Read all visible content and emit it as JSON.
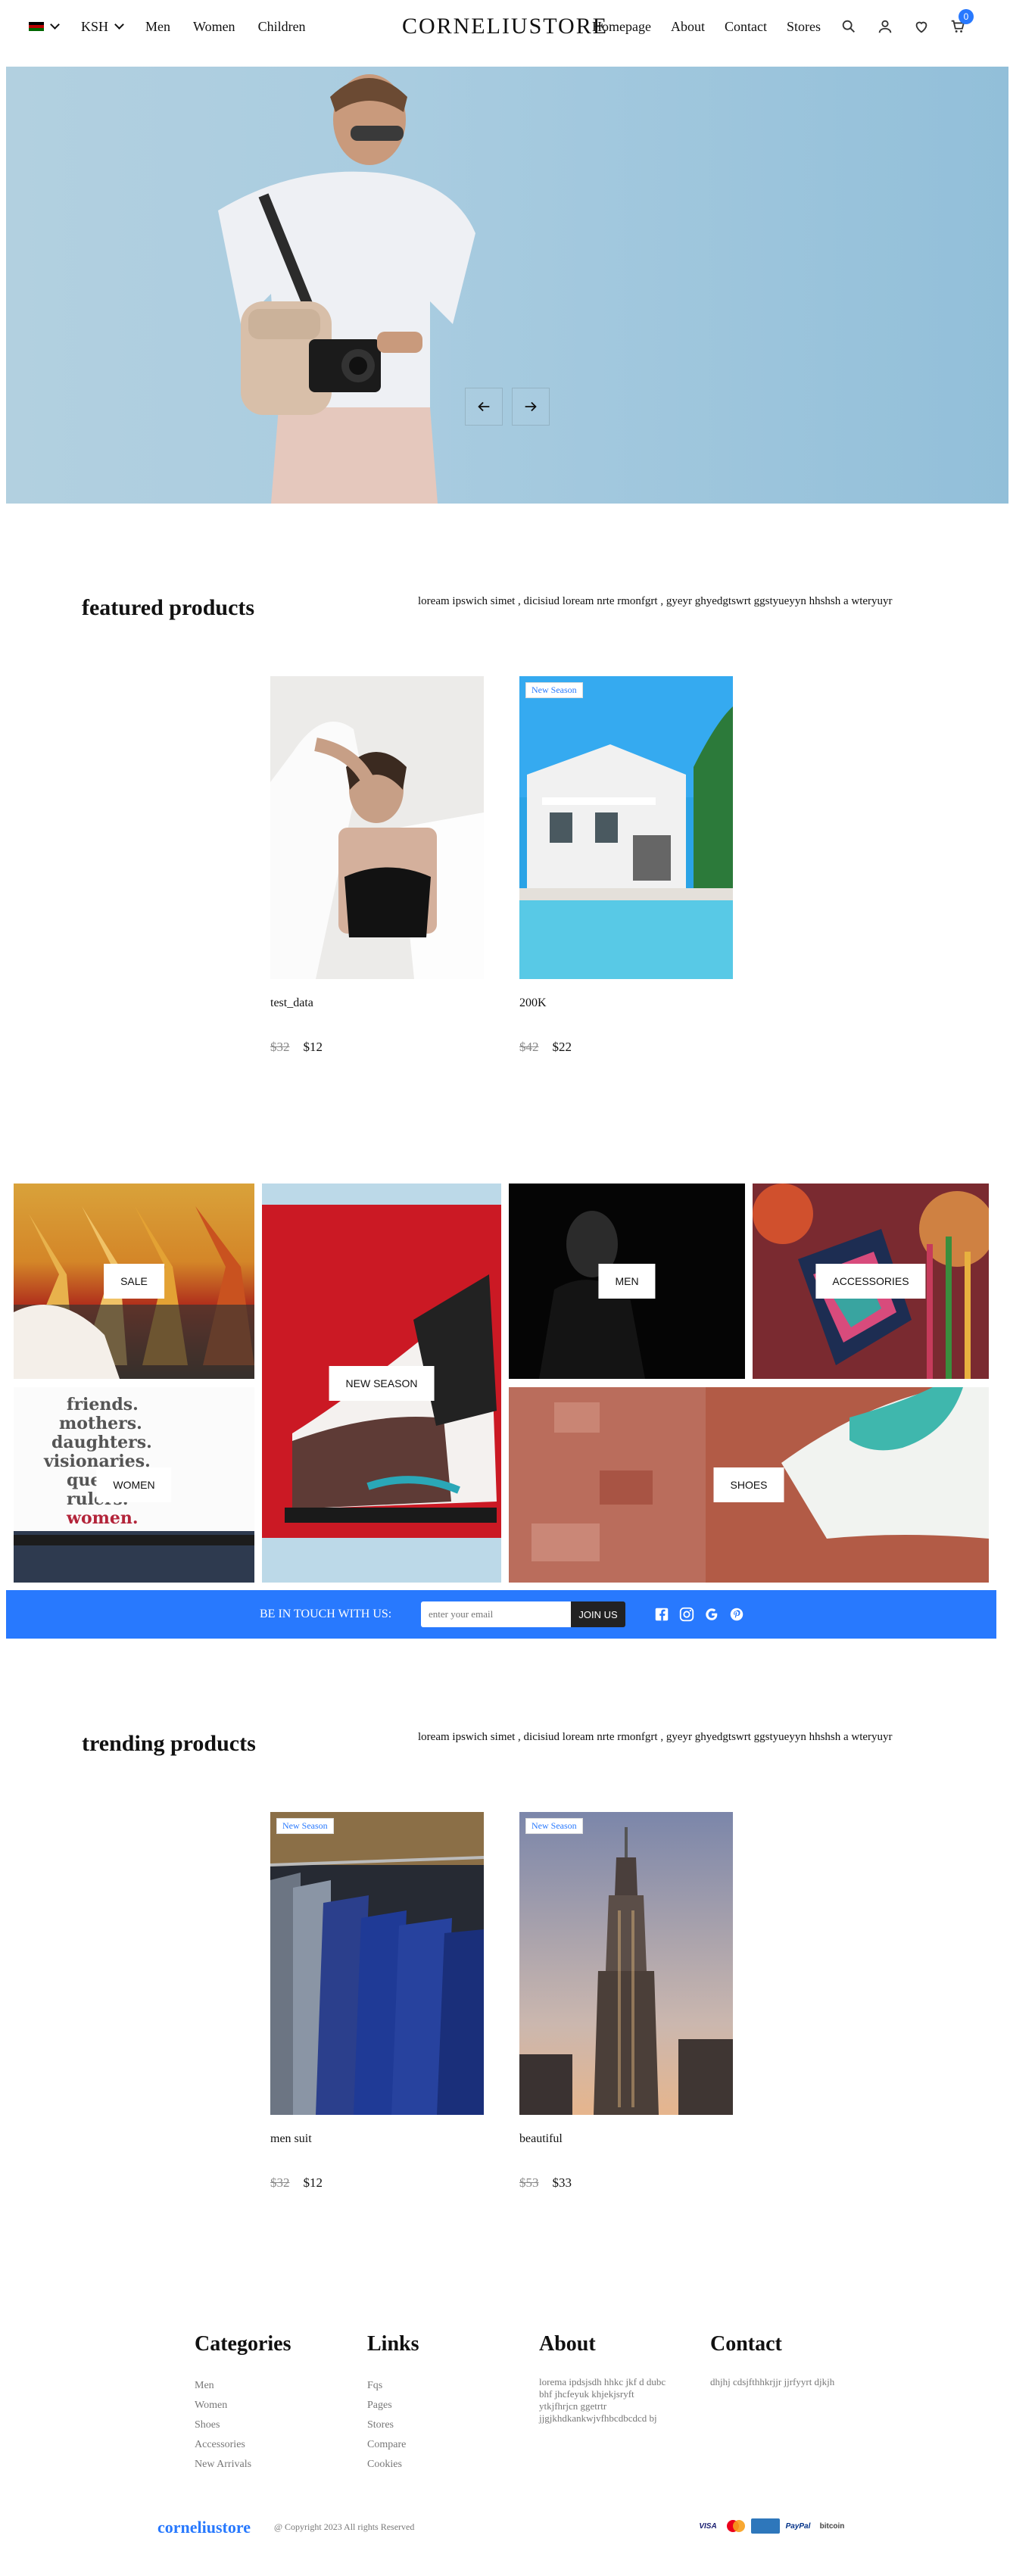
{
  "nav": {
    "currency": "KSH",
    "left_links": [
      "Men",
      "Women",
      "Children"
    ],
    "brand": "CORNELIUSTORE",
    "right_links": [
      "Homepage",
      "About",
      "Contact",
      "Stores"
    ],
    "cart_count": "0",
    "icons": [
      "search-icon",
      "user-icon",
      "heart-icon",
      "cart-icon"
    ]
  },
  "hero": {
    "prev_icon": "arrow-left-icon",
    "next_icon": "arrow-right-icon"
  },
  "featured": {
    "title": "featured products",
    "description": "loream ipswich simet , dicisiud loream nrte rmonfgrt , gyeyr ghyedgtswrt ggstyueyyn hhshsh a wteryuyr",
    "products": [
      {
        "name": "test_data",
        "old_price": "$32",
        "price": "$12",
        "badge": ""
      },
      {
        "name": "200K",
        "old_price": "$42",
        "price": "$22",
        "badge": "New Season"
      }
    ]
  },
  "categories": {
    "sale": "SALE",
    "women": "WOMEN",
    "new_season": "NEW SEASON",
    "men": "MEN",
    "accessories": "ACCESSORIES",
    "shoes": "SHOES",
    "tshirt_text": [
      "friends.",
      "mothers.",
      "daughters.",
      "visionaries.",
      "queens.",
      "rulers.",
      "women."
    ]
  },
  "newsletter": {
    "title": "BE IN TOUCH WITH US:",
    "placeholder": "enter your email",
    "button": "JOIN US",
    "social": [
      "facebook-icon",
      "instagram-icon",
      "google-icon",
      "pinterest-icon"
    ]
  },
  "trending": {
    "title": "trending products",
    "description": "loream ipswich simet , dicisiud loream nrte rmonfgrt , gyeyr ghyedgtswrt ggstyueyyn hhshsh a wteryuyr",
    "products": [
      {
        "name": "men suit",
        "old_price": "$32",
        "price": "$12",
        "badge": "New Season"
      },
      {
        "name": "beautiful",
        "old_price": "$53",
        "price": "$33",
        "badge": "New Season"
      }
    ]
  },
  "footer": {
    "categories": {
      "title": "Categories",
      "items": [
        "Men",
        "Women",
        "Shoes",
        "Accessories",
        "New Arrivals"
      ]
    },
    "links": {
      "title": "Links",
      "items": [
        "Fqs",
        "Pages",
        "Stores",
        "Compare",
        "Cookies"
      ]
    },
    "about": {
      "title": "About",
      "text": "lorema ipdsjsdh hhkc jkf d dubc bhf jhcfeyuk khjekjsryft ytkjfhrjcn ggetrtr jjgjkhdkankwjvfhbcdbcdcd bj"
    },
    "contact": {
      "title": "Contact",
      "text": "dhjhj cdsjfthhkrjjr jjrfyyrt djkjh"
    },
    "brand": "corneliustore",
    "copyright": "@ Copyright 2023 All rights Reserved",
    "payments": [
      "VISA",
      "mastercard",
      "amex",
      "PayPal",
      "bitcoin"
    ]
  }
}
